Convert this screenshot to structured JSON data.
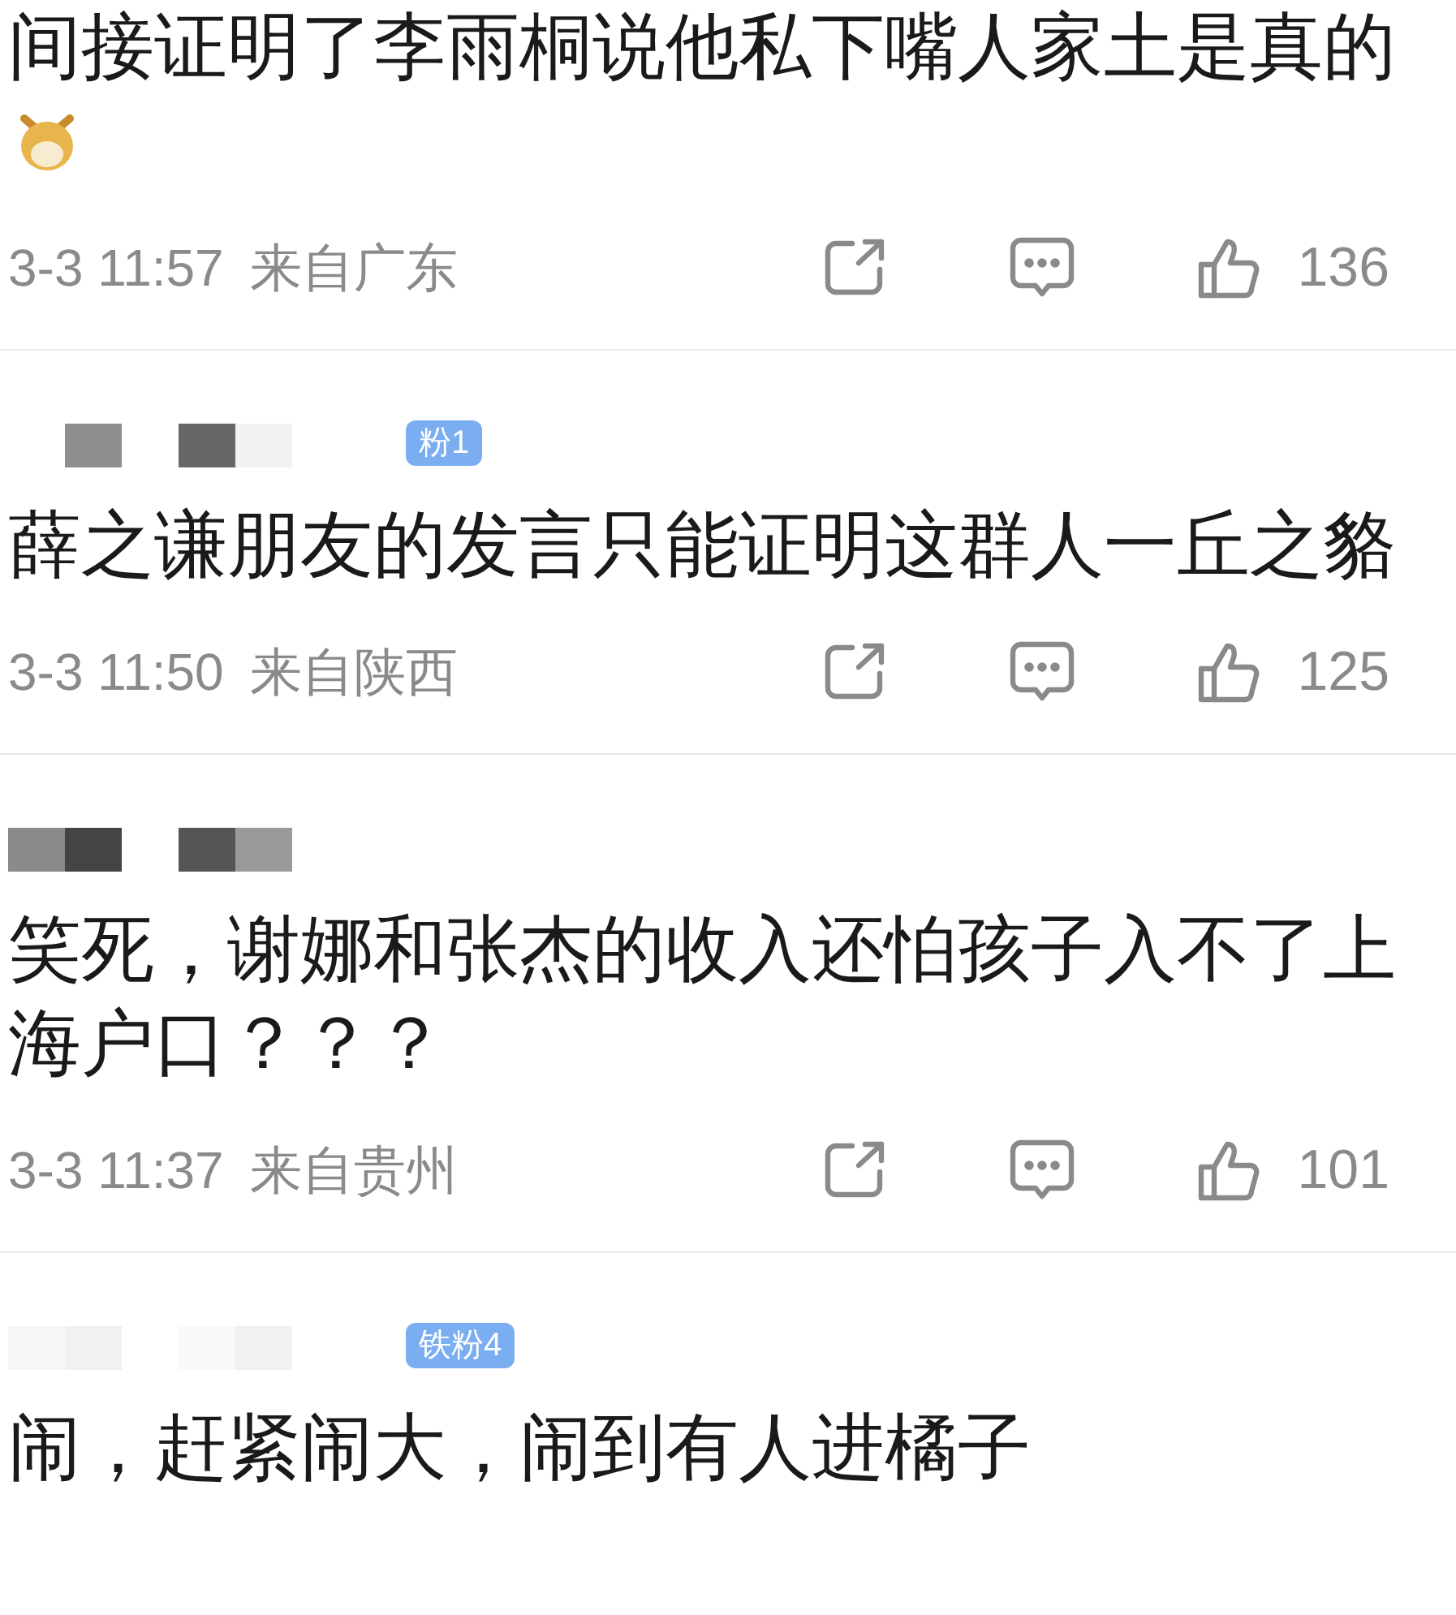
{
  "comments": [
    {
      "text": "间接证明了李雨桐说他私下嘴人家土是真的",
      "emoji": true,
      "time": "3-3 11:57",
      "location": "来自广东",
      "likes": "136"
    },
    {
      "user_blurred": true,
      "badge": "粉1",
      "text": "薛之谦朋友的发言只能证明这群人一丘之貉",
      "emoji": false,
      "time": "3-3 11:50",
      "location": "来自陕西",
      "likes": "125"
    },
    {
      "user_blurred": true,
      "text": "笑死，谢娜和张杰的收入还怕孩子入不了上海户口？？？",
      "emoji": false,
      "time": "3-3 11:37",
      "location": "来自贵州",
      "likes": "101"
    },
    {
      "user_blurred": true,
      "badge": "铁粉4",
      "text": "闹，赶紧闹大，闹到有人进橘子",
      "emoji": false
    }
  ]
}
